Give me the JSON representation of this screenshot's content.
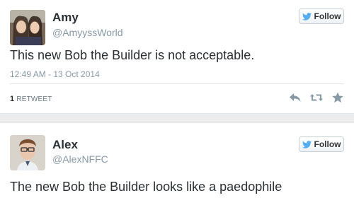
{
  "tweets": [
    {
      "name": "Amy",
      "handle": "@AmyyssWorld",
      "follow_label": "Follow",
      "text": "This new Bob the Builder is not acceptable.",
      "timestamp": "12:49 AM - 13 Oct 2014",
      "retweet_count": "1",
      "retweet_label": "RETWEET"
    },
    {
      "name": "Alex",
      "handle": "@AlexNFFC",
      "follow_label": "Follow",
      "text": "The new Bob the Builder looks like a paedophile"
    }
  ],
  "colors": {
    "bird": "#55acee",
    "muted": "#8899a6",
    "text": "#292f33"
  },
  "icons": [
    "twitter-bird-icon",
    "reply-icon",
    "retweet-icon",
    "favorite-icon"
  ]
}
